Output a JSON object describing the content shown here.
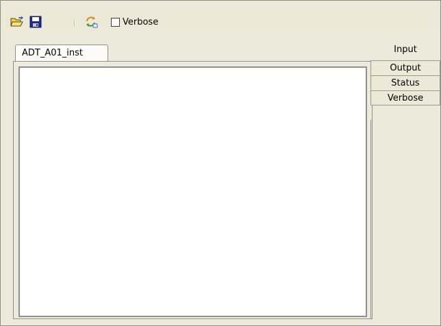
{
  "toolbar": {
    "open_icon": "open-folder-icon",
    "save_icon": "save-floppy-icon",
    "refresh_icon": "refresh-arrows-icon",
    "verbose_label": "Verbose",
    "verbose_checked": false
  },
  "main": {
    "active_tab": "ADT_A01_inst"
  },
  "side_tabs": [
    {
      "label": "Input"
    },
    {
      "label": "Output"
    },
    {
      "label": "Status"
    },
    {
      "label": "Verbose"
    }
  ],
  "colors": {
    "toolbar_bg": "#ece9d8",
    "panel_bg": "#ebeadb",
    "border": "#8f8f8f"
  }
}
